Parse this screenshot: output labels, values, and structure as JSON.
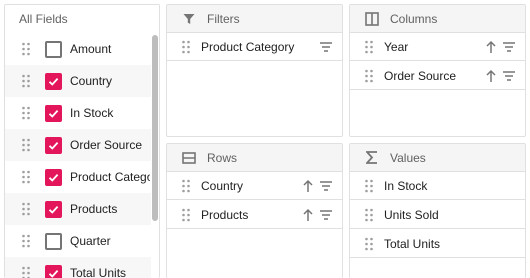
{
  "field_list": {
    "title": "All Fields",
    "items": [
      {
        "label": "Amount",
        "checked": false
      },
      {
        "label": "Country",
        "checked": true
      },
      {
        "label": "In Stock",
        "checked": true
      },
      {
        "label": "Order Source",
        "checked": true
      },
      {
        "label": "Product Category",
        "checked": true
      },
      {
        "label": "Products",
        "checked": true
      },
      {
        "label": "Quarter",
        "checked": false
      },
      {
        "label": "Total Units",
        "checked": true
      }
    ]
  },
  "filters": {
    "title": "Filters",
    "items": [
      {
        "label": "Product Category"
      }
    ]
  },
  "columns": {
    "title": "Columns",
    "items": [
      {
        "label": "Year"
      },
      {
        "label": "Order Source"
      }
    ]
  },
  "rows": {
    "title": "Rows",
    "items": [
      {
        "label": "Country"
      },
      {
        "label": "Products"
      }
    ]
  },
  "values": {
    "title": "Values",
    "items": [
      {
        "label": "In Stock"
      },
      {
        "label": "Units Sold"
      },
      {
        "label": "Total Units"
      }
    ]
  },
  "colors": {
    "accent": "#e3165b",
    "icon": "#757575",
    "border": "#e0e0e0",
    "header_bg": "#f5f5f5"
  },
  "icons": {
    "filters": "filter-funnel-icon",
    "columns": "columns-icon",
    "rows": "rows-icon",
    "values": "sigma-icon",
    "drag": "drag-handle-icon",
    "sort": "sort-ascending-icon",
    "filter_action": "filter-lines-icon"
  }
}
